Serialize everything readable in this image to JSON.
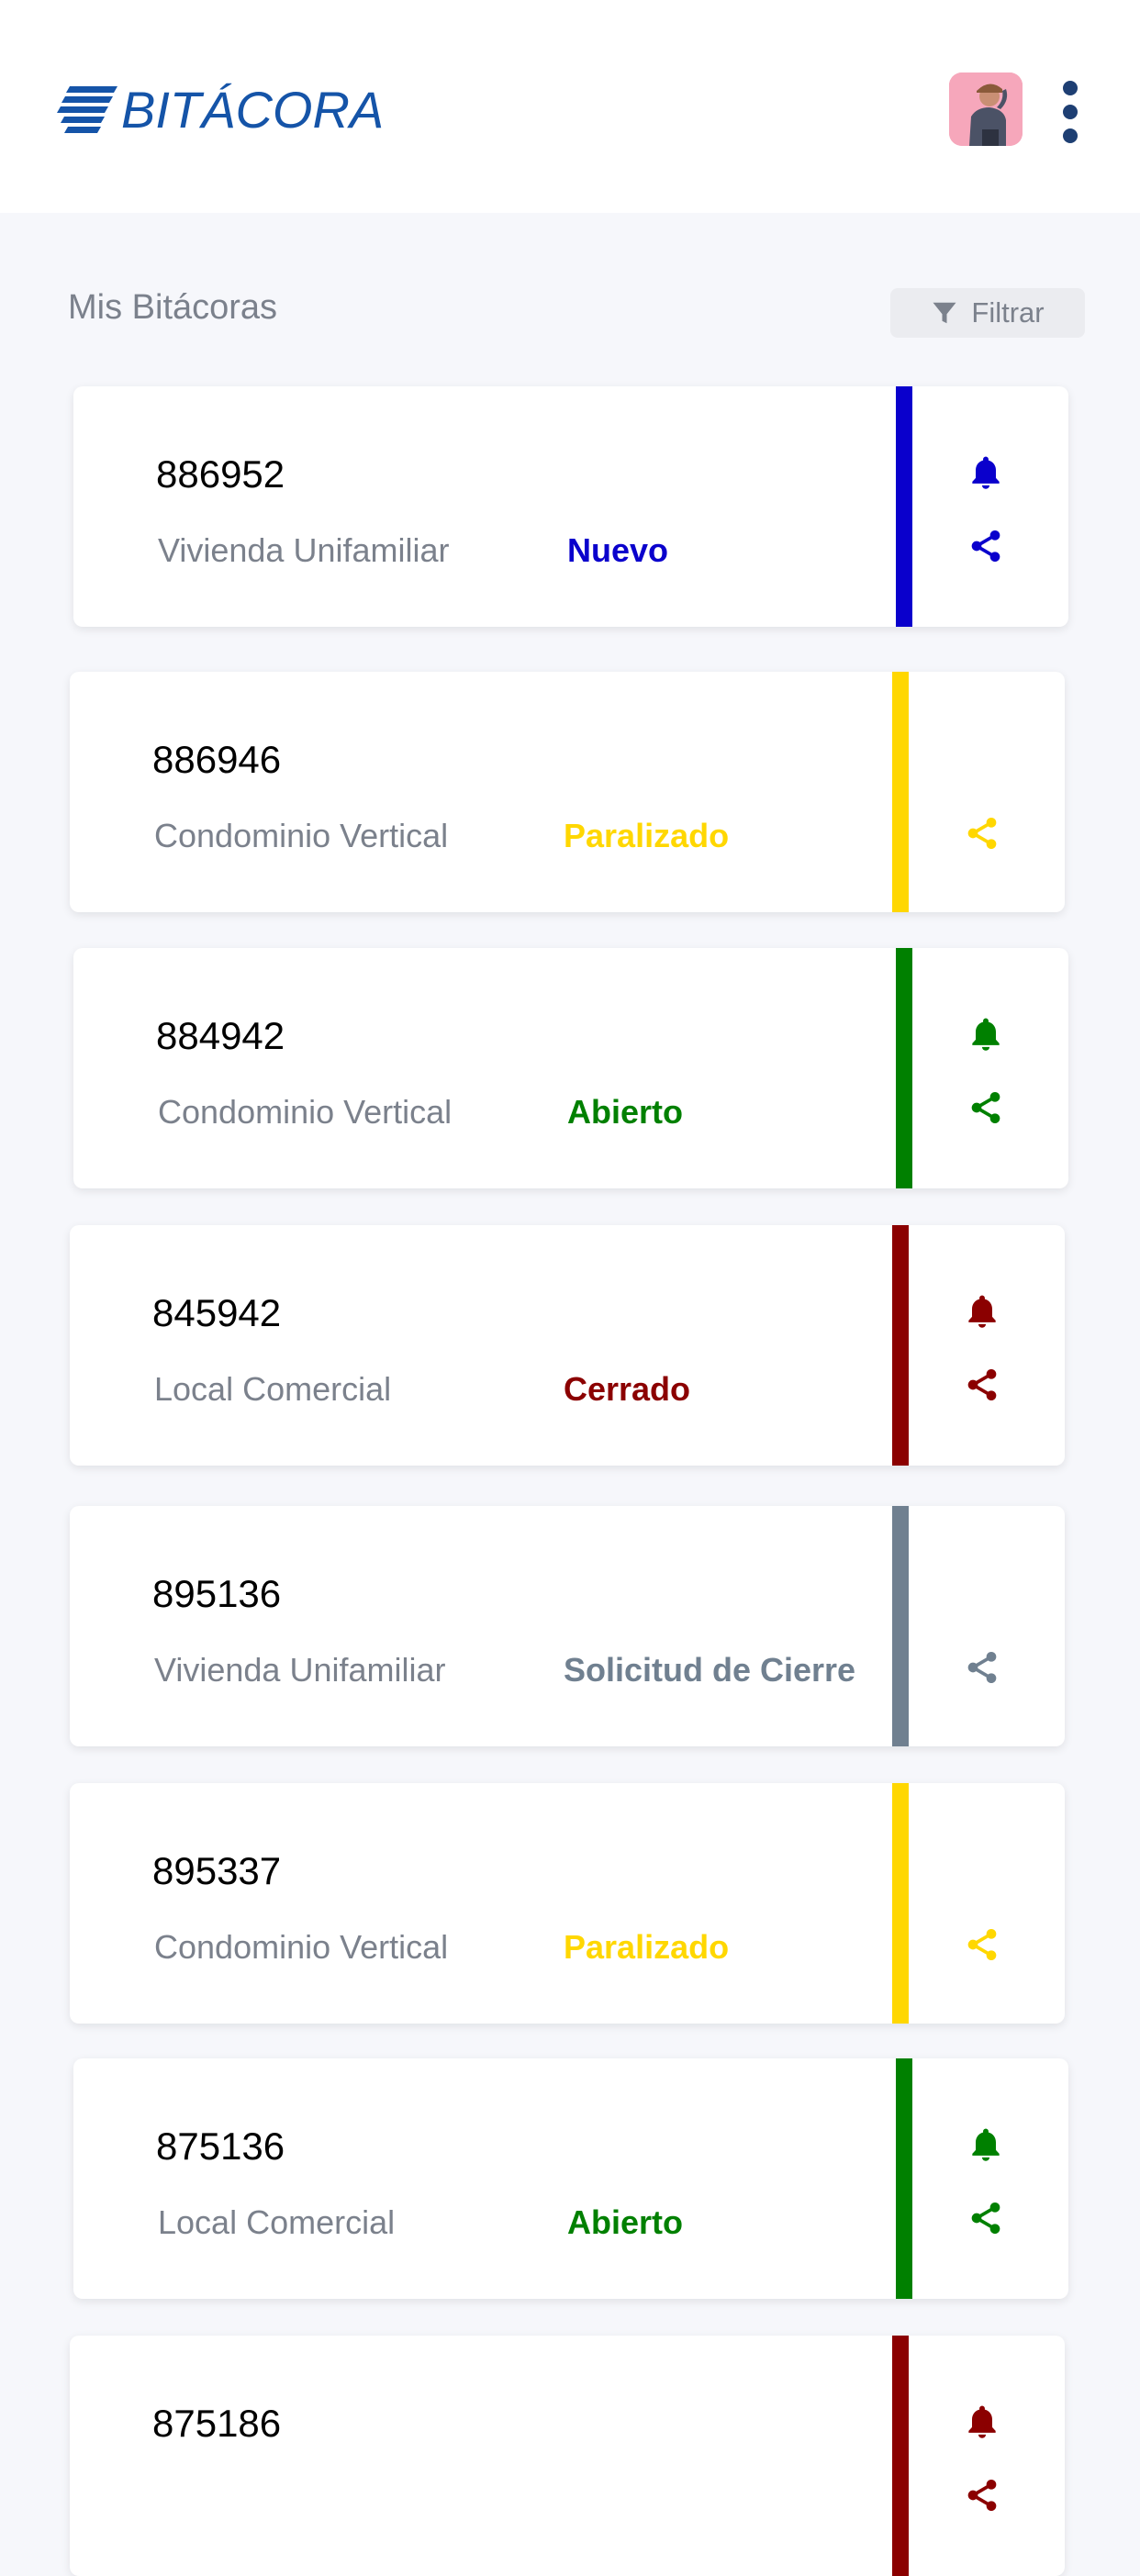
{
  "header": {
    "logo_text": "BITÁCORA",
    "brand_color": "#1554a8"
  },
  "main": {
    "section_title": "Mis Bitácoras",
    "filter_label": "Filtrar"
  },
  "cards": [
    {
      "code": "886952",
      "type": "Vivienda Unifamiliar",
      "status": "Nuevo",
      "color": "#0a00cc",
      "has_bell": true
    },
    {
      "code": "886946",
      "type": "Condominio Vertical",
      "status": "Paralizado",
      "color": "#ffd700",
      "has_bell": false
    },
    {
      "code": "884942",
      "type": "Condominio Vertical",
      "status": "Abierto",
      "color": "#008000",
      "has_bell": true
    },
    {
      "code": "845942",
      "type": "Local Comercial",
      "status": "Cerrado",
      "color": "#8b0000",
      "has_bell": true
    },
    {
      "code": "895136",
      "type": "Vivienda Unifamiliar",
      "status": "Solicitud de Cierre",
      "color": "#708090",
      "has_bell": false
    },
    {
      "code": "895337",
      "type": "Condominio Vertical",
      "status": "Paralizado",
      "color": "#ffd700",
      "has_bell": false
    },
    {
      "code": "875136",
      "type": "Local Comercial",
      "status": "Abierto",
      "color": "#008000",
      "has_bell": true
    },
    {
      "code": "875186",
      "type": "",
      "status": "",
      "color": "#8b0000",
      "has_bell": true
    }
  ]
}
